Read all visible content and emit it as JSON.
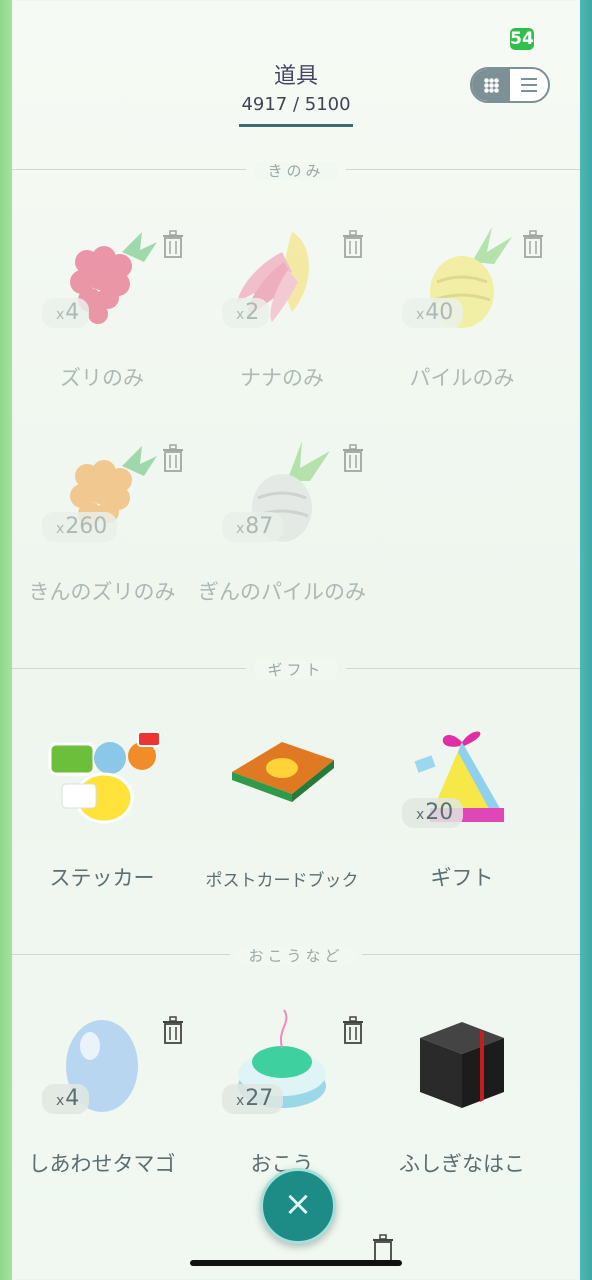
{
  "status": {
    "battery": "54"
  },
  "header": {
    "title": "道具",
    "count": "4917 / 5100"
  },
  "sections": {
    "berries": "きのみ",
    "gifts": "ギフト",
    "incense": "おこうなど"
  },
  "items": {
    "razz": {
      "name": "ズリのみ",
      "qty": "4"
    },
    "nanab": {
      "name": "ナナのみ",
      "qty": "2"
    },
    "pinap": {
      "name": "パイルのみ",
      "qty": "40"
    },
    "golden_razz": {
      "name": "きんのズリのみ",
      "qty": "260"
    },
    "silver_pinap": {
      "name": "ぎんのパイルのみ",
      "qty": "87"
    },
    "sticker": {
      "name": "ステッカー"
    },
    "postcard": {
      "name": "ポストカードブック"
    },
    "gift": {
      "name": "ギフト",
      "qty": "20"
    },
    "lucky_egg": {
      "name": "しあわせタマゴ",
      "qty": "4"
    },
    "incense": {
      "name": "おこう",
      "qty": "27"
    },
    "mystery_box": {
      "name": "ふしぎなはこ"
    }
  },
  "qty_prefix": "x",
  "close_symbol": "×",
  "colors": {
    "accent": "#1e8c86",
    "text": "#5b6f73",
    "battery": "#2fbf4a"
  },
  "icons": [
    "trash-icon",
    "grid-icon",
    "list-icon",
    "close-icon"
  ]
}
